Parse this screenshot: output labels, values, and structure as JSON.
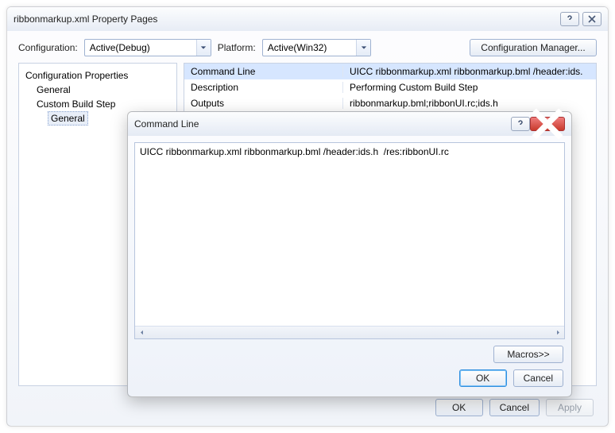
{
  "parent": {
    "title": "ribbonmarkup.xml Property Pages",
    "config_label": "Configuration:",
    "config_value": "Active(Debug)",
    "platform_label": "Platform:",
    "platform_value": "Active(Win32)",
    "config_mgr_button": "Configuration Manager...",
    "tree": {
      "root": "Configuration Properties",
      "n1": "General",
      "n2": "Custom Build Step",
      "n2a": "General"
    },
    "grid": [
      {
        "key": "Command Line",
        "val": "UICC ribbonmarkup.xml ribbonmarkup.bml /header:ids."
      },
      {
        "key": "Description",
        "val": "Performing Custom Build Step"
      },
      {
        "key": "Outputs",
        "val": "ribbonmarkup.bml;ribbonUI.rc;ids.h"
      }
    ],
    "footer": {
      "ok": "OK",
      "cancel": "Cancel",
      "apply": "Apply"
    }
  },
  "dialog": {
    "title": "Command Line",
    "text": "UICC ribbonmarkup.xml ribbonmarkup.bml /header:ids.h  /res:ribbonUI.rc",
    "macros": "Macros>>",
    "ok": "OK",
    "cancel": "Cancel"
  }
}
